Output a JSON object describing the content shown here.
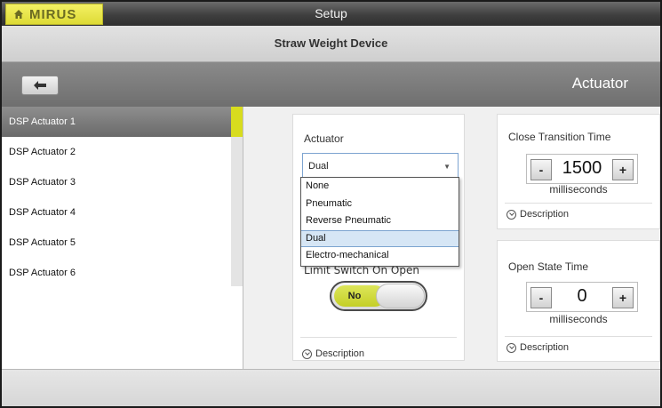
{
  "header": {
    "brand": "MIRUS",
    "title": "Setup",
    "subtitle": "Straw Weight Device",
    "section": "Actuator",
    "back_icon": "arrow-left-icon"
  },
  "sidebar": {
    "items": [
      {
        "label": "DSP Actuator 1",
        "selected": true
      },
      {
        "label": "DSP Actuator 2",
        "selected": false
      },
      {
        "label": "DSP Actuator 3",
        "selected": false
      },
      {
        "label": "DSP Actuator 4",
        "selected": false
      },
      {
        "label": "DSP Actuator 5",
        "selected": false
      },
      {
        "label": "DSP Actuator 6",
        "selected": false
      }
    ]
  },
  "actuator": {
    "label": "Actuator",
    "selected": "Dual",
    "options": [
      "None",
      "Pneumatic",
      "Reverse Pneumatic",
      "Dual",
      "Electro-mechanical"
    ],
    "limit_label": "Limit Switch On Open",
    "toggle_value": "No",
    "description": "Description"
  },
  "close_transition": {
    "label": "Close Transition Time",
    "minus": "-",
    "plus": "+",
    "value": "1500",
    "unit": "milliseconds",
    "description": "Description"
  },
  "open_state": {
    "label": "Open State Time",
    "minus": "-",
    "plus": "+",
    "value": "0",
    "unit": "milliseconds",
    "description": "Description"
  },
  "colors": {
    "brand": "#dedb36",
    "accent": "#d8dc1e",
    "toggle": "#c4cf27",
    "selection": "#d6e6f5"
  }
}
